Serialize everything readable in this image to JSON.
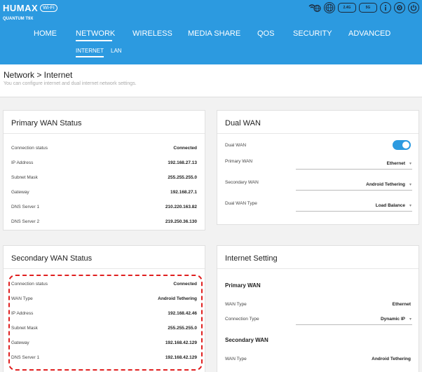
{
  "header": {
    "brand": "HUMAX",
    "brand_badge": "Wi-Fi",
    "model": "QUANTUM T9X",
    "icons": {
      "wifi_globe": "wifi-globe-icon",
      "band_24": "2.4G",
      "band_5": "5G",
      "info": "info-icon",
      "settings": "gear-icon",
      "power": "power-icon"
    },
    "nav": [
      "HOME",
      "NETWORK",
      "WIRELESS",
      "MEDIA SHARE",
      "QOS",
      "SECURITY",
      "ADVANCED"
    ],
    "subnav": [
      "INTERNET",
      "LAN"
    ]
  },
  "page": {
    "title": "Network > Internet",
    "subtitle": "You can configure internet and dual internet network settings."
  },
  "primary_wan": {
    "title": "Primary WAN Status",
    "rows": [
      {
        "label": "Connection status",
        "value": "Connected"
      },
      {
        "label": "IP Address",
        "value": "192.168.27.13"
      },
      {
        "label": "Subnet Mask",
        "value": "255.255.255.0"
      },
      {
        "label": "Gateway",
        "value": "192.168.27.1"
      },
      {
        "label": "DNS Server 1",
        "value": "210.220.163.82"
      },
      {
        "label": "DNS Server 2",
        "value": "219.250.36.130"
      }
    ]
  },
  "dual_wan": {
    "title": "Dual WAN",
    "toggle_label": "Dual WAN",
    "primary_label": "Primary WAN",
    "primary_value": "Ethernet",
    "secondary_label": "Secondary WAN",
    "secondary_value": "Android Tethering",
    "type_label": "Dual WAN Type",
    "type_value": "Load Balance"
  },
  "secondary_wan": {
    "title": "Secondary WAN Status",
    "rows": [
      {
        "label": "Connection status",
        "value": "Connected"
      },
      {
        "label": "WAN Type",
        "value": "Android Tethering"
      },
      {
        "label": "IP Address",
        "value": "192.168.42.46"
      },
      {
        "label": "Subnet Mask",
        "value": "255.255.255.0"
      },
      {
        "label": "Gateway",
        "value": "192.168.42.129"
      },
      {
        "label": "DNS Server 1",
        "value": "192.168.42.129"
      }
    ]
  },
  "internet_setting": {
    "title": "Internet Setting",
    "primary_header": "Primary WAN",
    "p_wan_type_label": "WAN Type",
    "p_wan_type_value": "Ethernet",
    "p_conn_type_label": "Connection Type",
    "p_conn_type_value": "Dynamic IP",
    "secondary_header": "Secondary WAN",
    "s_wan_type_label": "WAN Type",
    "s_wan_type_value": "Android Tethering"
  },
  "colors": {
    "header_blue": "#2c9ae0",
    "highlight_red": "#e02020"
  }
}
